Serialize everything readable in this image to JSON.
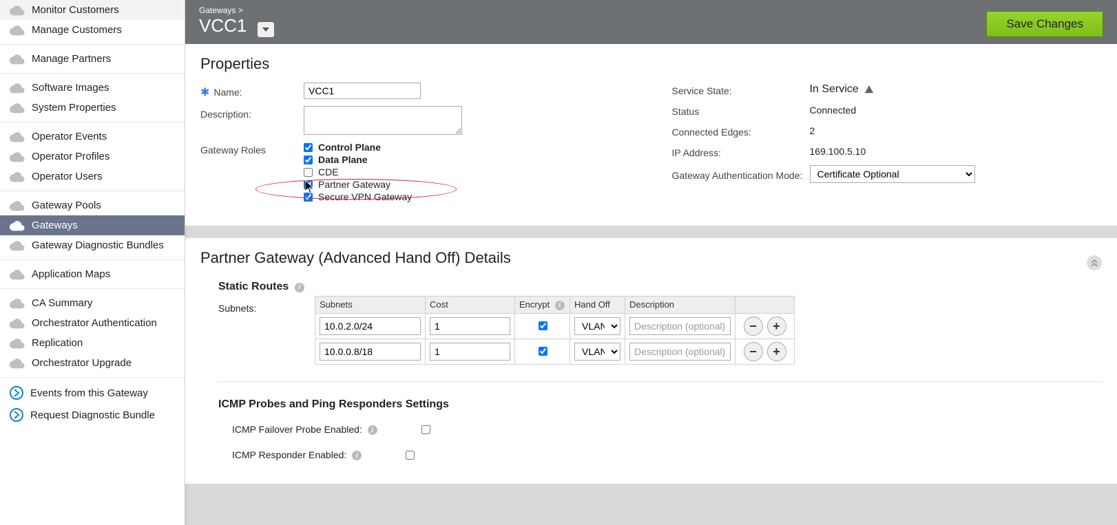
{
  "sidebar": {
    "groups": [
      [
        "Monitor Customers",
        "Manage Customers"
      ],
      [
        "Manage Partners"
      ],
      [
        "Software Images",
        "System Properties"
      ],
      [
        "Operator Events",
        "Operator Profiles",
        "Operator Users"
      ],
      [
        "Gateway Pools",
        "Gateways",
        "Gateway Diagnostic Bundles"
      ],
      [
        "Application Maps"
      ],
      [
        "CA Summary",
        "Orchestrator Authentication",
        "Replication",
        "Orchestrator Upgrade"
      ]
    ],
    "active": "Gateways",
    "links": [
      "Events from this Gateway",
      "Request Diagnostic Bundle"
    ]
  },
  "header": {
    "breadcrumb": "Gateways >",
    "title": "VCC1",
    "save": "Save Changes"
  },
  "properties": {
    "heading": "Properties",
    "name_label": "Name:",
    "name_value": "VCC1",
    "desc_label": "Description:",
    "desc_value": "",
    "roles_label": "Gateway Roles",
    "roles": [
      {
        "label": "Control Plane",
        "checked": true,
        "bold": true
      },
      {
        "label": "Data Plane",
        "checked": true,
        "bold": true
      },
      {
        "label": "CDE",
        "checked": false,
        "bold": false
      },
      {
        "label": "Partner Gateway",
        "checked": true,
        "bold": false
      },
      {
        "label": "Secure VPN Gateway",
        "checked": true,
        "bold": false
      }
    ],
    "status": {
      "service_state_label": "Service State:",
      "service_state_value": "In Service",
      "status_label": "Status",
      "status_value": "Connected",
      "edges_label": "Connected Edges:",
      "edges_value": "2",
      "ip_label": "IP Address:",
      "ip_value": "169.100.5.10",
      "auth_label": "Gateway Authentication Mode:",
      "auth_value": "Certificate Optional"
    }
  },
  "pg": {
    "heading": "Partner Gateway (Advanced Hand Off) Details",
    "static_routes": "Static Routes",
    "subnets_label": "Subnets:",
    "columns": {
      "subnets": "Subnets",
      "cost": "Cost",
      "encrypt": "Encrypt",
      "handoff": "Hand Off",
      "desc": "Description"
    },
    "rows": [
      {
        "subnet": "10.0.2.0/24",
        "cost": "1",
        "encrypt": true,
        "handoff": "VLAN",
        "desc": ""
      },
      {
        "subnet": "10.0.0.8/18",
        "cost": "1",
        "encrypt": true,
        "handoff": "VLAN",
        "desc": ""
      }
    ],
    "desc_placeholder": "Description (optional)",
    "icmp_heading": "ICMP Probes and Ping Responders Settings",
    "icmp_failover": "ICMP Failover Probe Enabled:",
    "icmp_responder": "ICMP Responder Enabled:"
  }
}
